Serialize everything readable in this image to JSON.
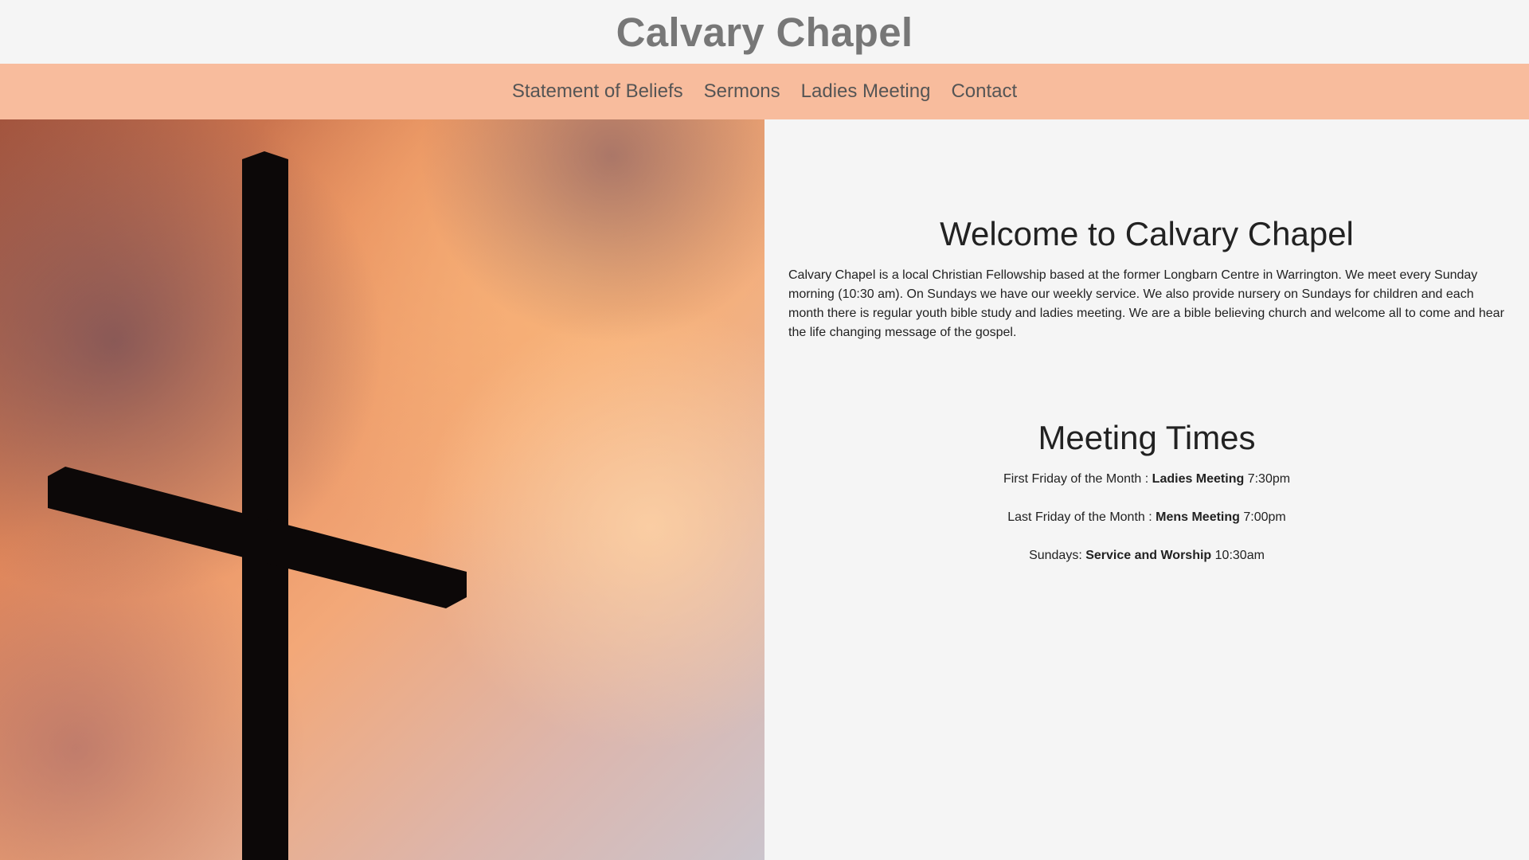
{
  "header": {
    "title": "Calvary Chapel"
  },
  "nav": {
    "items": [
      {
        "label": "Statement of Beliefs"
      },
      {
        "label": "Sermons"
      },
      {
        "label": "Ladies Meeting"
      },
      {
        "label": "Contact"
      }
    ]
  },
  "hero": {
    "image": "cross-silhouette-sunset-sky"
  },
  "welcome": {
    "title": "Welcome to Calvary Chapel",
    "text": "Calvary Chapel is a local Christian Fellowship based at the former Longbarn Centre in Warrington. We meet every Sunday morning (10:30 am). On Sundays we have our weekly service. We also provide nursery on Sundays for children and each month there is regular youth bible study and ladies meeting. We are a bible believing church and welcome all to come and hear the life changing message of the gospel."
  },
  "meetings": {
    "title": "Meeting Times",
    "items": [
      {
        "prefix": "First Friday of the Month : ",
        "name": "Ladies Meeting",
        "time": " 7:30pm"
      },
      {
        "prefix": "Last Friday of the Month : ",
        "name": "Mens Meeting",
        "time": " 7:00pm"
      },
      {
        "prefix": "Sundays: ",
        "name": "Service and Worship",
        "time": " 10:30am"
      }
    ]
  },
  "colors": {
    "nav_background": "#f8bc9d",
    "title_color": "#777777",
    "page_background": "#f5f5f5"
  }
}
